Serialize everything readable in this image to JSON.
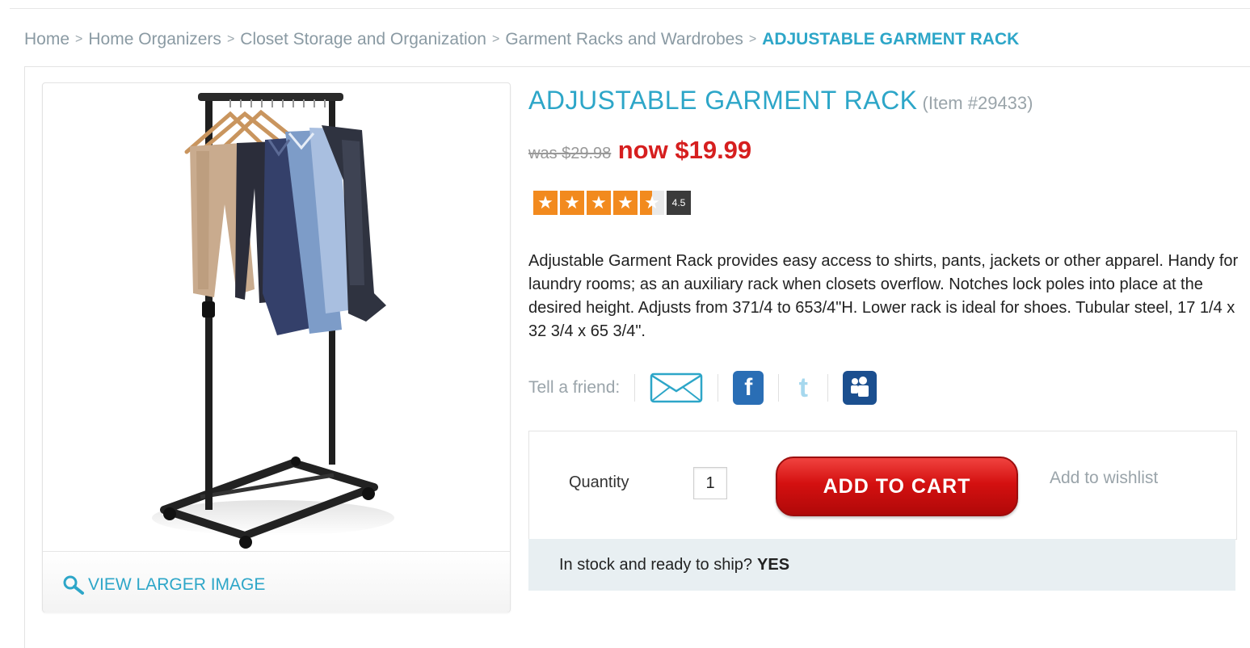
{
  "breadcrumb": {
    "items": [
      "Home",
      "Home Organizers",
      "Closet Storage and Organization",
      "Garment Racks and Wardrobes"
    ],
    "separator": ">",
    "current": "ADJUSTABLE GARMENT RACK"
  },
  "product": {
    "title": "ADJUSTABLE GARMENT RACK",
    "item_number": "(Item #29433)",
    "was_price": "was $29.98",
    "now_price": "now $19.99",
    "rating": 4.5,
    "rating_label": "4.5",
    "rating_max": 5,
    "description": "Adjustable Garment Rack provides easy access to shirts, pants, jackets or other apparel. Handy for laundry rooms; as an auxiliary rack when closets overflow. Notches lock poles into place at the desired height. Adjusts from 371/4 to 653/4\"H. Lower rack is ideal for shoes. Tubular steel, 17 1/4 x 32 3/4 x 65 3/4\"."
  },
  "image_panel": {
    "view_larger_label": "VIEW LARGER IMAGE",
    "icon": "magnifier-icon"
  },
  "share": {
    "label": "Tell a friend:",
    "icons": [
      "email-icon",
      "facebook-icon",
      "twitter-icon",
      "myspace-icon"
    ],
    "facebook_glyph": "f",
    "twitter_glyph": "t"
  },
  "cart": {
    "quantity_label": "Quantity",
    "quantity_value": "1",
    "add_to_cart_label": "ADD TO CART",
    "wishlist_label": "Add to wishlist"
  },
  "stock": {
    "label": "In stock and ready to ship?",
    "value": "YES"
  },
  "colors": {
    "accent": "#2da6c8",
    "sale_price": "#d61f1f",
    "star": "#f28a1e",
    "cart_button": "#d41010"
  }
}
